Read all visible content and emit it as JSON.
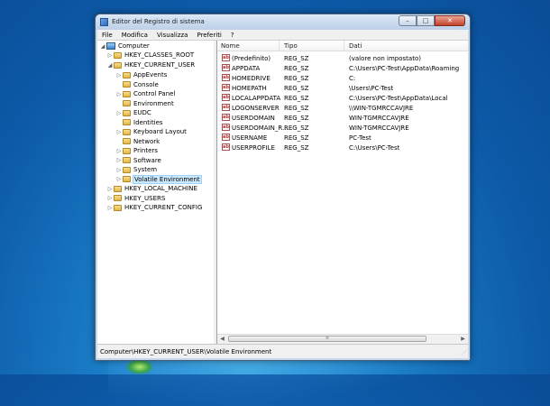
{
  "window": {
    "title": "Editor del Registro di sistema"
  },
  "title_buttons": {
    "minimize": "–",
    "maximize": "□",
    "close": "✕"
  },
  "menu": [
    "File",
    "Modifica",
    "Visualizza",
    "Preferiti",
    "?"
  ],
  "tree": {
    "root": "Computer",
    "hives": [
      {
        "label": "HKEY_CLASSES_ROOT",
        "expanded": false
      },
      {
        "label": "HKEY_CURRENT_USER",
        "expanded": true,
        "children": [
          "AppEvents",
          "Console",
          "Control Panel",
          "Environment",
          "EUDC",
          "Identities",
          "Keyboard Layout",
          "Network",
          "Printers",
          "Software",
          "System",
          "Volatile Environment"
        ],
        "selected": "Volatile Environment"
      },
      {
        "label": "HKEY_LOCAL_MACHINE",
        "expanded": false
      },
      {
        "label": "HKEY_USERS",
        "expanded": false
      },
      {
        "label": "HKEY_CURRENT_CONFIG",
        "expanded": false
      }
    ]
  },
  "list": {
    "columns": [
      "Nome",
      "Tipo",
      "Dati"
    ],
    "rows": [
      {
        "name": "(Predefinito)",
        "type": "REG_SZ",
        "data": "(valore non impostato)"
      },
      {
        "name": "APPDATA",
        "type": "REG_SZ",
        "data": "C:\\Users\\PC-Test\\AppData\\Roaming"
      },
      {
        "name": "HOMEDRIVE",
        "type": "REG_SZ",
        "data": "C:"
      },
      {
        "name": "HOMEPATH",
        "type": "REG_SZ",
        "data": "\\Users\\PC-Test"
      },
      {
        "name": "LOCALAPPDATA",
        "type": "REG_SZ",
        "data": "C:\\Users\\PC-Test\\AppData\\Local"
      },
      {
        "name": "LOGONSERVER",
        "type": "REG_SZ",
        "data": "\\\\WIN-TGMRCCAVJRE"
      },
      {
        "name": "USERDOMAIN",
        "type": "REG_SZ",
        "data": "WIN-TGMRCCAVJRE"
      },
      {
        "name": "USERDOMAIN_R...",
        "type": "REG_SZ",
        "data": "WIN-TGMRCCAVJRE"
      },
      {
        "name": "USERNAME",
        "type": "REG_SZ",
        "data": "PC-Test"
      },
      {
        "name": "USERPROFILE",
        "type": "REG_SZ",
        "data": "C:\\Users\\PC-Test"
      }
    ],
    "value_icon": "ab"
  },
  "status": "Computer\\HKEY_CURRENT_USER\\Volatile Environment",
  "colors": {
    "selection": "#cce8ff",
    "desktop": "#1a7cc6"
  }
}
